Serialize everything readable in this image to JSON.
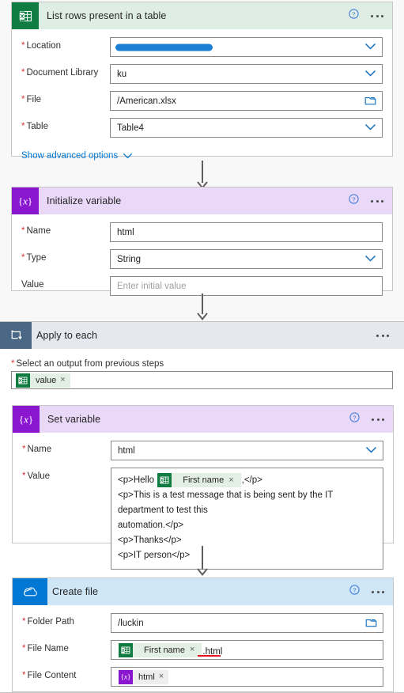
{
  "flow": {
    "steps": [
      {
        "id": "list-rows",
        "title": "List rows present in a table",
        "icon": "excel-icon",
        "help_label": "?",
        "more_label": "···",
        "fields": [
          {
            "label": "Location",
            "required": true,
            "value": "",
            "redacted": true,
            "control": "dropdown"
          },
          {
            "label": "Document Library",
            "required": true,
            "value": "ku",
            "control": "dropdown"
          },
          {
            "label": "File",
            "required": true,
            "value": "/American.xlsx",
            "control": "folder"
          },
          {
            "label": "Table",
            "required": true,
            "value": "Table4",
            "control": "dropdown"
          }
        ],
        "advanced_options_label": "Show advanced options"
      },
      {
        "id": "initialize-variable",
        "title": "Initialize variable",
        "icon": "variable-icon",
        "fields": [
          {
            "label": "Name",
            "required": true,
            "value": "html",
            "control": "text"
          },
          {
            "label": "Type",
            "required": true,
            "value": "String",
            "control": "dropdown"
          },
          {
            "label": "Value",
            "required": false,
            "value": "",
            "placeholder": "Enter initial value",
            "control": "text"
          }
        ]
      },
      {
        "id": "apply-to-each",
        "title": "Apply to each",
        "icon": "loop-icon",
        "select_output_label": "Select an output from previous steps",
        "select_output_token": {
          "label": "value",
          "icon": "excel-icon",
          "remove_label": "×"
        }
      },
      {
        "id": "set-variable",
        "title": "Set variable",
        "icon": "variable-icon",
        "fields": [
          {
            "label": "Name",
            "required": true,
            "value": "html",
            "control": "dropdown"
          }
        ],
        "value_label": "Value",
        "value_lines": [
          {
            "before": "<p>Hello ",
            "token": {
              "label": "First name",
              "icon": "excel-icon",
              "remove_label": "×"
            },
            "after": ",</p>"
          },
          {
            "text": "<p>This is a test message that is being sent by the IT department to test this"
          },
          {
            "text": "automation.</p>"
          },
          {
            "text": "<p>Thanks</p>"
          },
          {
            "text": "<p>IT person</p>"
          }
        ]
      },
      {
        "id": "create-file",
        "title": "Create file",
        "icon": "onedrive-icon",
        "fields": [
          {
            "label": "Folder Path",
            "required": true,
            "value": "/luckin",
            "control": "folder"
          }
        ],
        "file_name_label": "File Name",
        "file_name_token": {
          "label": "First name",
          "icon": "excel-icon",
          "remove_label": "×"
        },
        "file_name_suffix": ".html",
        "file_content_label": "File Content",
        "file_content_token": {
          "label": "html",
          "icon": "variable-icon",
          "remove_label": "×"
        }
      }
    ]
  },
  "colors": {
    "excel_green": "#107c41",
    "excel_header": "#dfeee4",
    "variable_purple": "#8a17cf",
    "variable_header": "#e9d8f7",
    "loop_blue": "#4a6785",
    "loop_header": "#e5e9ef",
    "onedrive_blue": "#0078d4",
    "onedrive_header": "#cfe6f7",
    "accent_link": "#0078d4",
    "required_red": "#d13438",
    "error_underline": "#e81123"
  },
  "icons": {
    "help": "help-icon",
    "more": "more-options-icon",
    "chevron_down": "chevron-down-icon",
    "folder": "folder-picker-icon"
  }
}
